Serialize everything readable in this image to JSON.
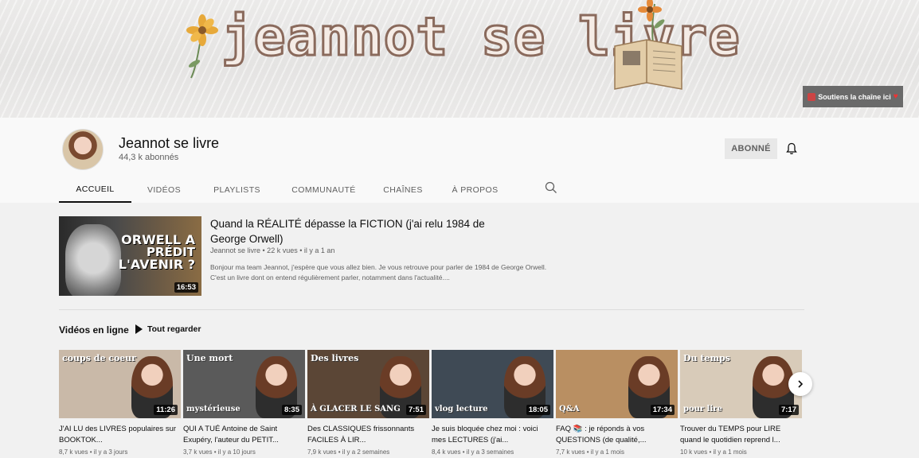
{
  "banner": {
    "title": "jeannot se livre",
    "support_label": "Soutiens la chaîne ici"
  },
  "channel": {
    "name": "Jeannot se livre",
    "subscribers": "44,3 k abonnés",
    "subscribed_label": "ABONNÉ"
  },
  "tabs": [
    {
      "label": "ACCUEIL",
      "active": true
    },
    {
      "label": "VIDÉOS"
    },
    {
      "label": "PLAYLISTS"
    },
    {
      "label": "COMMUNAUTÉ"
    },
    {
      "label": "CHAÎNES"
    },
    {
      "label": "À PROPOS"
    }
  ],
  "featured": {
    "thumb_line1": "ORWELL A",
    "thumb_line2": "PRÉDIT",
    "thumb_line3": "L'AVENIR ?",
    "duration": "16:53",
    "title": "Quand la RÉALITÉ dépasse la FICTION (j'ai relu 1984 de George Orwell)",
    "meta": "Jeannot se livre • 22 k vues • il y a 1 an",
    "description": "Bonjour ma team Jeannot, j'espère que vous allez bien. Je vous retrouve pour parler de 1984 de George Orwell. C'est un livre dont on entend régulièrement parler, notamment dans l'actualité...."
  },
  "shelf": {
    "title": "Vidéos en ligne",
    "play_all": "Tout regarder",
    "videos": [
      {
        "overlay": "coups de coeur",
        "overlay2": "",
        "duration": "11:26",
        "title": "J'AI LU des LIVRES populaires sur BOOKTOK...",
        "meta": "8,7 k vues • il y a 3 jours",
        "bg": "#c9b9a8"
      },
      {
        "overlay": "Une mort",
        "overlay2": "mystérieuse",
        "duration": "8:35",
        "title": "QUI A TUÉ Antoine de Saint Exupéry, l'auteur du PETIT...",
        "meta": "3,7 k vues • il y a 10 jours",
        "bg": "#5a5a5a"
      },
      {
        "overlay": "Des livres",
        "overlay2": "À GLACER LE SANG",
        "duration": "7:51",
        "title": "Des CLASSIQUES frissonnants FACILES À LIR...",
        "meta": "7,9 k vues • il y a 2 semaines",
        "bg": "#5b4636"
      },
      {
        "overlay": "",
        "overlay2": "vlog lecture",
        "duration": "18:05",
        "title": "Je suis bloquée chez moi : voici mes LECTURES (j'ai...",
        "meta": "8,4 k vues • il y a 3 semaines",
        "bg": "#3f4a55"
      },
      {
        "overlay": "",
        "overlay2": "Q&A",
        "duration": "17:34",
        "title": "FAQ 📚 : je réponds à vos QUESTIONS (de qualité,...",
        "meta": "7,7 k vues • il y a 1 mois",
        "bg": "#b98f62"
      },
      {
        "overlay": "Du temps",
        "overlay2": "pour lire",
        "duration": "7:17",
        "title": "Trouver du TEMPS pour LIRE quand le quotidien reprend l...",
        "meta": "10 k vues • il y a 1 mois",
        "bg": "#d8cbb9"
      }
    ]
  },
  "colors": {
    "banner_text_stroke": "#8a6a5c",
    "subscribed_bg": "#e8e8e8",
    "support_bg": "#6a6a6a"
  },
  "icons": {
    "bell": "bell-icon",
    "search": "search-icon",
    "play": "play-icon",
    "next": "chevron-right-icon"
  }
}
